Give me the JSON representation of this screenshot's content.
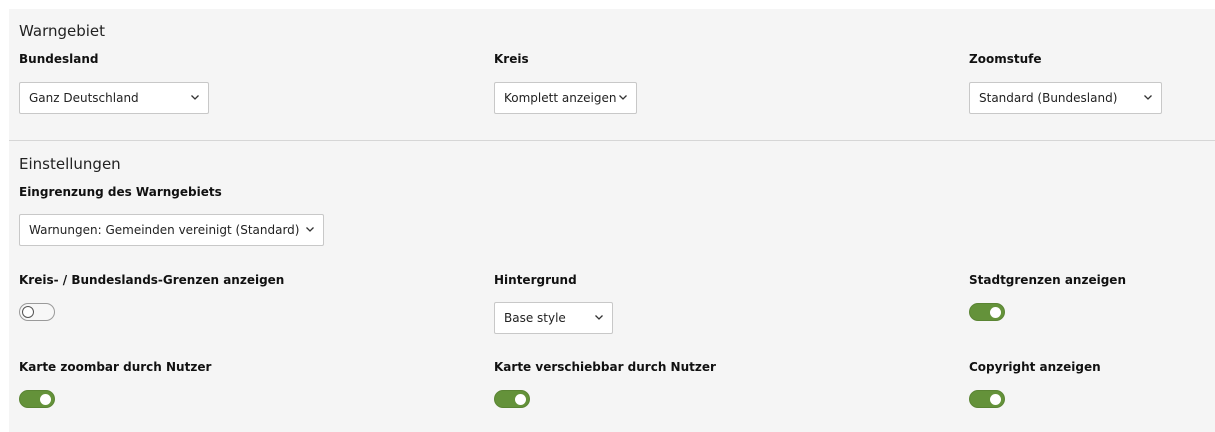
{
  "warngebiet": {
    "title": "Warngebiet",
    "bundesland": {
      "label": "Bundesland",
      "value": "Ganz Deutschland"
    },
    "kreis": {
      "label": "Kreis",
      "value": "Komplett anzeigen"
    },
    "zoomstufe": {
      "label": "Zoomstufe",
      "value": "Standard (Bundesland)"
    }
  },
  "einstellungen": {
    "title": "Einstellungen",
    "eingrenzung": {
      "label": "Eingrenzung des Warngebiets",
      "value": "Warnungen: Gemeinden vereinigt (Standard)"
    },
    "grenzen": {
      "label": "Kreis- / Bundeslands-Grenzen anzeigen",
      "enabled": false
    },
    "hintergrund": {
      "label": "Hintergrund",
      "value": "Base style"
    },
    "stadtgrenzen": {
      "label": "Stadtgrenzen anzeigen",
      "enabled": true
    },
    "zoombar": {
      "label": "Karte zoombar durch Nutzer",
      "enabled": true
    },
    "verschiebbar": {
      "label": "Karte verschiebbar durch Nutzer",
      "enabled": true
    },
    "copyright": {
      "label": "Copyright anzeigen",
      "enabled": true
    }
  },
  "colors": {
    "toggle_on": "#64923a",
    "panel_background": "#f5f5f5"
  },
  "icons": {
    "select_arrow": "chevron-down-icon",
    "toggle_knob": "toggle-knob"
  }
}
